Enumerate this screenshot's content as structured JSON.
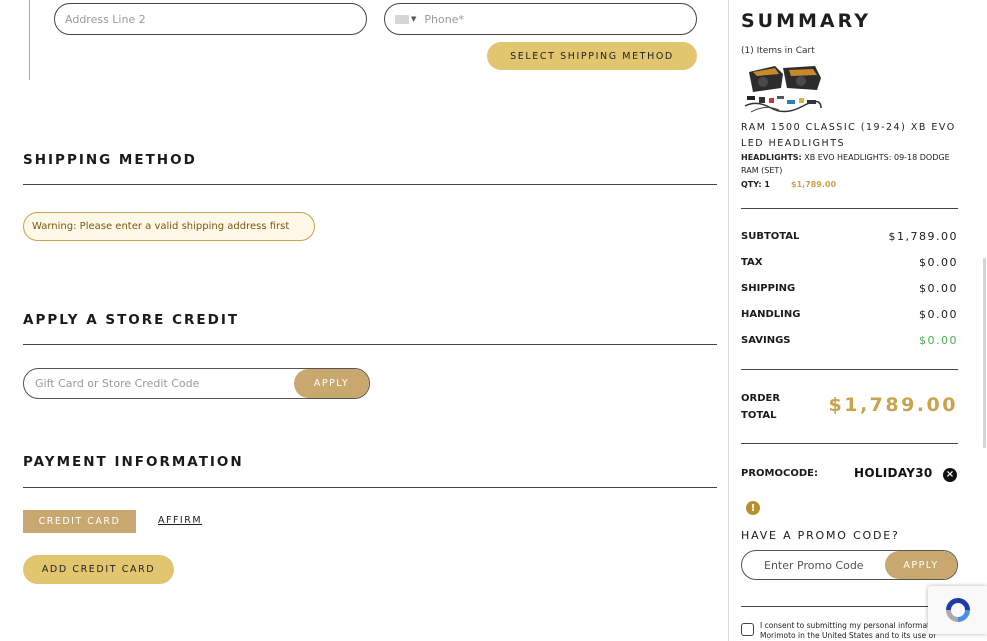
{
  "address": {
    "line2_placeholder": "Address Line 2",
    "phone_placeholder": "Phone*",
    "select_shipping_label": "SELECT SHIPPING METHOD"
  },
  "shipping": {
    "title": "SHIPPING METHOD",
    "warning": "Warning: Please enter a valid shipping address first"
  },
  "store_credit": {
    "title": "APPLY A STORE CREDIT",
    "placeholder": "Gift Card or Store Credit Code",
    "apply_label": "APPLY"
  },
  "payment": {
    "title": "PAYMENT INFORMATION",
    "tabs": [
      {
        "label": "CREDIT CARD",
        "active": true
      },
      {
        "label": "AFFIRM",
        "active": false
      }
    ],
    "add_card_label": "ADD CREDIT CARD"
  },
  "summary": {
    "title": "SUMMARY",
    "items_count": "(1) Items in Cart",
    "product": {
      "name": "RAM 1500 CLASSIC (19-24) XB EVO LED HEADLIGHTS",
      "spec_label": "HEADLIGHTS:",
      "spec_value": "XB EVO HEADLIGHTS: 09-18 DODGE RAM (SET)",
      "qty": "QTY: 1",
      "price": "$1,789.00"
    },
    "lines": [
      {
        "label": "SUBTOTAL",
        "value": "$1,789.00"
      },
      {
        "label": "TAX",
        "value": "$0.00"
      },
      {
        "label": "SHIPPING",
        "value": "$0.00"
      },
      {
        "label": "HANDLING",
        "value": "$0.00"
      },
      {
        "label": "SAVINGS",
        "value": "$0.00"
      }
    ],
    "order_total_label": "ORDER TOTAL",
    "order_total_value": "$1,789.00",
    "promocode_label": "PROMOCODE:",
    "promocode_value": "HOLIDAY30",
    "have_promo_label": "HAVE A PROMO CODE?",
    "promo_placeholder": "Enter Promo Code",
    "promo_apply_label": "APPLY",
    "consent_text": "I consent to submitting my personal information to Morimoto in the United States and to its use of"
  },
  "colors": {
    "gold": "#e2c56f",
    "tan": "#c9a870",
    "price_gold": "#c9a34e",
    "savings_green": "#4caf50"
  }
}
